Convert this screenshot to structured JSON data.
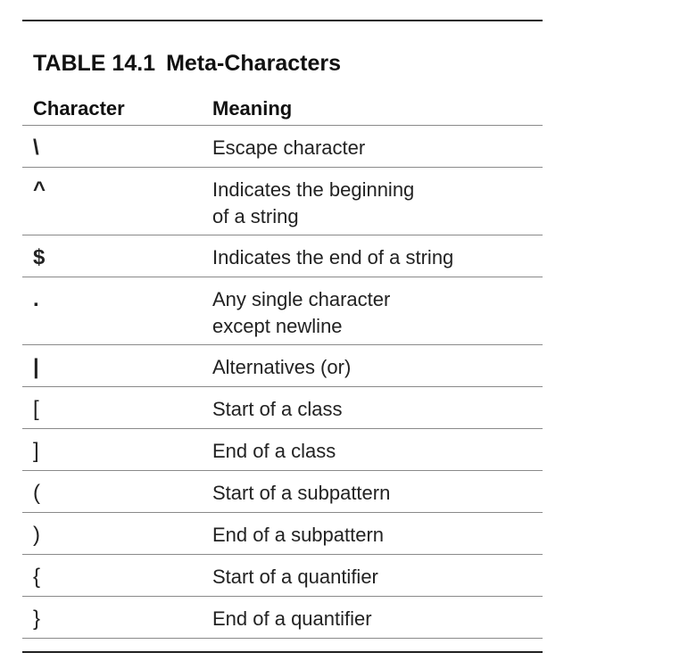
{
  "caption": {
    "number": "TABLE 14.1",
    "title": "Meta-Characters"
  },
  "headers": {
    "character": "Character",
    "meaning": "Meaning"
  },
  "rows": [
    {
      "character": "\\",
      "meaning": "Escape character"
    },
    {
      "character": "^",
      "meaning": "Indicates the beginning\nof a string"
    },
    {
      "character": "$",
      "meaning": "Indicates the end of a string"
    },
    {
      "character": ".",
      "meaning": "Any single character\nexcept newline"
    },
    {
      "character": "|",
      "meaning": "Alternatives (or)"
    },
    {
      "character": "[",
      "meaning": "Start of a class"
    },
    {
      "character": "]",
      "meaning": "End of a class"
    },
    {
      "character": "(",
      "meaning": "Start of a subpattern"
    },
    {
      "character": ")",
      "meaning": "End of a subpattern"
    },
    {
      "character": "{",
      "meaning": "Start of a quantifier"
    },
    {
      "character": "}",
      "meaning": "End of a quantifier"
    }
  ]
}
